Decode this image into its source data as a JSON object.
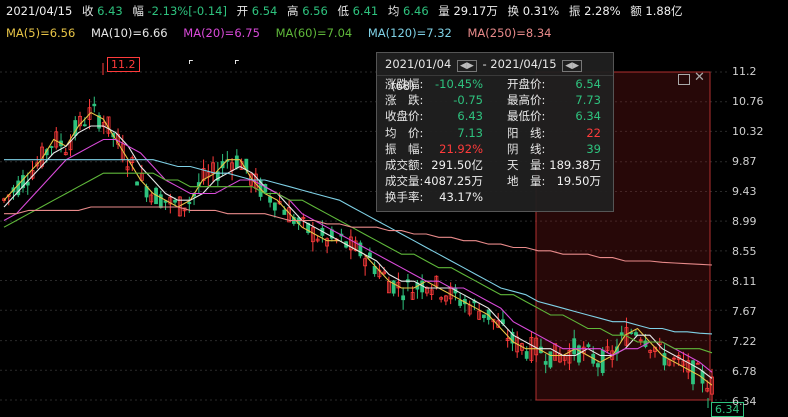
{
  "quote": {
    "date": "2021/04/15",
    "close_label": "收",
    "close": "6.43",
    "change_label": "幅",
    "change": "-2.13%[-0.14]",
    "open_label": "开",
    "open": "6.54",
    "high_label": "高",
    "high": "6.56",
    "low_label": "低",
    "low": "6.41",
    "avg_label": "均",
    "avg": "6.46",
    "volume_label": "量",
    "volume": "29.17万",
    "turnover_label": "换",
    "turnover": "0.31%",
    "amplitude_label": "振",
    "amplitude": "2.28%",
    "amount_label": "额",
    "amount": "1.88亿"
  },
  "ma": [
    {
      "label": "MA(5)=6.56",
      "color": "#e8c547"
    },
    {
      "label": "MA(10)=6.66",
      "color": "#e8e8e8"
    },
    {
      "label": "MA(20)=6.75",
      "color": "#d94ad9"
    },
    {
      "label": "MA(60)=7.04",
      "color": "#5fb83a"
    },
    {
      "label": "MA(120)=7.32",
      "color": "#7fd1e6"
    },
    {
      "label": "MA(250)=8.34",
      "color": "#e88a8a"
    }
  ],
  "yaxis": [
    "11.2",
    "10.76",
    "10.32",
    "9.87",
    "9.43",
    "8.99",
    "8.55",
    "8.11",
    "7.67",
    "7.22",
    "6.78",
    "6.34"
  ],
  "markers": {
    "max": "11.2",
    "min": "6.34"
  },
  "tooltip": {
    "range": "2021/01/04",
    "range_sep": "-",
    "range_end": "2021/04/15",
    "count": "(68)",
    "rows": [
      {
        "k": "涨跌幅:",
        "v": "-10.45%",
        "vc": "green",
        "k2": "开盘价:",
        "v2": "6.54",
        "v2c": "green"
      },
      {
        "k": "涨　跌:",
        "v": "-0.75",
        "vc": "green",
        "k2": "最高价:",
        "v2": "7.73",
        "v2c": "green"
      },
      {
        "k": "收盘价:",
        "v": "6.43",
        "vc": "green",
        "k2": "最低价:",
        "v2": "6.34",
        "v2c": "green"
      },
      {
        "k": "均　价:",
        "v": "7.13",
        "vc": "green",
        "k2": "阳　线:",
        "v2": "22",
        "v2c": "red"
      },
      {
        "k": "振　幅:",
        "v": "21.92%",
        "vc": "red",
        "k2": "阴　线:",
        "v2": "39",
        "v2c": "green"
      },
      {
        "k": "成交额:",
        "v": "291.50亿",
        "vc": "white",
        "k2": "天　量:",
        "v2": "189.38万",
        "v2c": "white"
      },
      {
        "k": "成交量:",
        "v": "4087.25万",
        "vc": "white",
        "k2": "地　量:",
        "v2": "19.50万",
        "v2c": "white"
      },
      {
        "k": "换手率:",
        "v": "43.17%",
        "vc": "white",
        "k2": "",
        "v2": "",
        "v2c": "white"
      }
    ]
  },
  "chart_data": {
    "type": "candlestick",
    "ylim": [
      6.34,
      11.2
    ],
    "ma_series": [
      {
        "name": "MA(5)",
        "color": "#e8c547",
        "values": [
          9.3,
          9.5,
          9.7,
          9.9,
          10.2,
          10.1,
          10.4,
          10.6,
          10.5,
          10.2,
          9.9,
          9.6,
          9.4,
          9.3,
          9.2,
          9.3,
          9.6,
          9.7,
          9.9,
          9.9,
          9.6,
          9.4,
          9.3,
          9.1,
          8.9,
          8.8,
          8.7,
          8.7,
          8.6,
          8.5,
          8.3,
          8.1,
          8.0,
          8.0,
          8.1,
          8.0,
          7.9,
          7.8,
          7.7,
          7.6,
          7.4,
          7.2,
          7.1,
          7.1,
          7.0,
          7.0,
          7.1,
          7.0,
          6.9,
          7.0,
          7.3,
          7.4,
          7.2,
          7.0,
          6.9,
          6.8,
          6.7,
          6.56
        ]
      },
      {
        "name": "MA(10)",
        "color": "#e8e8e8",
        "values": [
          9.2,
          9.4,
          9.6,
          9.8,
          10.0,
          10.1,
          10.3,
          10.4,
          10.4,
          10.3,
          10.1,
          9.8,
          9.6,
          9.4,
          9.3,
          9.3,
          9.4,
          9.6,
          9.7,
          9.8,
          9.7,
          9.5,
          9.4,
          9.2,
          9.0,
          8.9,
          8.8,
          8.7,
          8.6,
          8.5,
          8.4,
          8.2,
          8.1,
          8.1,
          8.0,
          8.0,
          8.0,
          7.9,
          7.8,
          7.7,
          7.5,
          7.3,
          7.2,
          7.1,
          7.1,
          7.0,
          7.0,
          7.1,
          7.0,
          7.0,
          7.1,
          7.3,
          7.3,
          7.1,
          7.0,
          6.9,
          6.8,
          6.66
        ]
      },
      {
        "name": "MA(20)",
        "color": "#d94ad9",
        "values": [
          9.0,
          9.1,
          9.3,
          9.5,
          9.7,
          9.9,
          10.0,
          10.1,
          10.2,
          10.2,
          10.1,
          10.0,
          9.8,
          9.6,
          9.5,
          9.4,
          9.4,
          9.4,
          9.5,
          9.6,
          9.6,
          9.5,
          9.4,
          9.3,
          9.1,
          9.0,
          8.9,
          8.8,
          8.7,
          8.6,
          8.5,
          8.4,
          8.3,
          8.2,
          8.1,
          8.1,
          8.0,
          8.0,
          7.9,
          7.8,
          7.7,
          7.5,
          7.4,
          7.3,
          7.2,
          7.1,
          7.1,
          7.1,
          7.1,
          7.0,
          7.1,
          7.1,
          7.2,
          7.2,
          7.1,
          7.0,
          6.9,
          6.75
        ]
      },
      {
        "name": "MA(60)",
        "color": "#5fb83a",
        "values": [
          8.9,
          9.0,
          9.1,
          9.2,
          9.3,
          9.4,
          9.5,
          9.6,
          9.7,
          9.7,
          9.7,
          9.7,
          9.7,
          9.6,
          9.6,
          9.5,
          9.5,
          9.5,
          9.5,
          9.5,
          9.5,
          9.4,
          9.4,
          9.3,
          9.3,
          9.2,
          9.1,
          9.0,
          8.9,
          8.8,
          8.7,
          8.6,
          8.5,
          8.5,
          8.4,
          8.3,
          8.3,
          8.2,
          8.1,
          8.0,
          7.9,
          7.9,
          7.8,
          7.7,
          7.6,
          7.6,
          7.5,
          7.4,
          7.4,
          7.3,
          7.3,
          7.2,
          7.2,
          7.2,
          7.1,
          7.1,
          7.1,
          7.04
        ]
      },
      {
        "name": "MA(120)",
        "color": "#7fd1e6",
        "values": [
          9.9,
          9.9,
          9.9,
          9.9,
          9.9,
          9.9,
          9.9,
          9.9,
          9.9,
          9.9,
          9.9,
          9.9,
          9.9,
          9.85,
          9.8,
          9.8,
          9.75,
          9.7,
          9.7,
          9.65,
          9.6,
          9.6,
          9.55,
          9.5,
          9.45,
          9.4,
          9.35,
          9.3,
          9.2,
          9.1,
          9.0,
          8.9,
          8.8,
          8.7,
          8.6,
          8.5,
          8.4,
          8.3,
          8.2,
          8.1,
          8.0,
          7.95,
          7.9,
          7.8,
          7.75,
          7.7,
          7.65,
          7.6,
          7.55,
          7.5,
          7.5,
          7.45,
          7.4,
          7.4,
          7.35,
          7.35,
          7.33,
          7.32
        ]
      },
      {
        "name": "MA(250)",
        "color": "#e88a8a",
        "values": [
          9.1,
          9.1,
          9.15,
          9.15,
          9.15,
          9.15,
          9.15,
          9.2,
          9.2,
          9.2,
          9.2,
          9.2,
          9.2,
          9.2,
          9.2,
          9.15,
          9.15,
          9.15,
          9.1,
          9.1,
          9.1,
          9.1,
          9.05,
          9.0,
          9.0,
          9.0,
          8.95,
          8.95,
          8.9,
          8.9,
          8.9,
          8.85,
          8.85,
          8.8,
          8.8,
          8.75,
          8.75,
          8.7,
          8.7,
          8.65,
          8.65,
          8.6,
          8.6,
          8.55,
          8.55,
          8.5,
          8.5,
          8.5,
          8.45,
          8.45,
          8.4,
          8.4,
          8.4,
          8.38,
          8.37,
          8.36,
          8.35,
          8.34
        ]
      }
    ]
  }
}
